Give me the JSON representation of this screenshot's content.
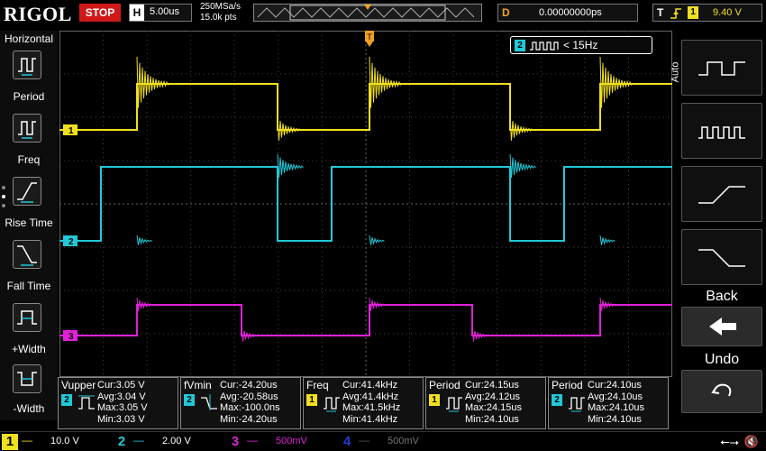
{
  "top": {
    "brand": "RIGOL",
    "run_state": "STOP",
    "horizontal_tag": "H",
    "timebase": "5.00us",
    "sample_rate": "250MSa/s",
    "points": "15.0k pts",
    "delay_tag": "D",
    "delay": "0.00000000ps",
    "trigger_tag": "T",
    "trigger_source": "1",
    "trigger_level": "9.40 V"
  },
  "left_menu": {
    "title": "Horizontal",
    "items": [
      {
        "label": "Period",
        "icon": "period-icon"
      },
      {
        "label": "Freq",
        "icon": "frequency-icon"
      },
      {
        "label": "Rise Time",
        "icon": "rise-time-icon"
      },
      {
        "label": "Fall Time",
        "icon": "fall-time-icon"
      },
      {
        "label": "+Width",
        "icon": "positive-width-icon"
      },
      {
        "label": "-Width",
        "icon": "negative-width-icon"
      }
    ]
  },
  "trigger_info": {
    "source": "2",
    "text": "< 15Hz"
  },
  "right_menu": {
    "mode": "Auto",
    "buttons": [
      {
        "icon": "square-wave-wide-icon"
      },
      {
        "icon": "square-wave-narrow-icon"
      },
      {
        "icon": "rising-edge-icon"
      },
      {
        "icon": "falling-edge-icon"
      }
    ],
    "back_label": "Back",
    "undo_label": "Undo"
  },
  "measurements": [
    {
      "name": "Vupper",
      "source": "2",
      "color": "#22c8d8",
      "cur": "Cur:3.05 V",
      "avg": "Avg:3.04 V",
      "max": "Max:3.05 V",
      "min": "Min:3.03 V"
    },
    {
      "name": "fVmin",
      "source": "2",
      "color": "#22c8d8",
      "cur": "Cur:-24.20us",
      "avg": "Avg:-20.58us",
      "max": "Max:-100.0ns",
      "min": "Min:-24.20us"
    },
    {
      "name": "Freq",
      "source": "1",
      "color": "#f0e020",
      "cur": "Cur:41.4kHz",
      "avg": "Avg:41.4kHz",
      "max": "Max:41.5kHz",
      "min": "Min:41.4kHz"
    },
    {
      "name": "Period",
      "source": "1",
      "color": "#f0e020",
      "cur": "Cur:24.15us",
      "avg": "Avg:24.12us",
      "max": "Max:24.15us",
      "min": "Min:24.10us"
    },
    {
      "name": "Period",
      "source": "2",
      "color": "#22c8d8",
      "cur": "Cur:24.10us",
      "avg": "Avg:24.10us",
      "max": "Max:24.10us",
      "min": "Min:24.10us"
    }
  ],
  "channels": [
    {
      "num": "1",
      "scale": "10.0 V",
      "color": "#f0e020"
    },
    {
      "num": "2",
      "scale": "2.00 V",
      "color": "#22c8d8"
    },
    {
      "num": "3",
      "scale": "500mV",
      "color": "#e020d8"
    },
    {
      "num": "4",
      "scale": "500mV",
      "color": "#2040d0"
    }
  ],
  "colors": {
    "ch1": "#f0e020",
    "ch2": "#22c8d8",
    "ch3": "#e020d8",
    "ch4": "#2040d0",
    "stop": "#d01818",
    "delay": "#f0a020"
  }
}
